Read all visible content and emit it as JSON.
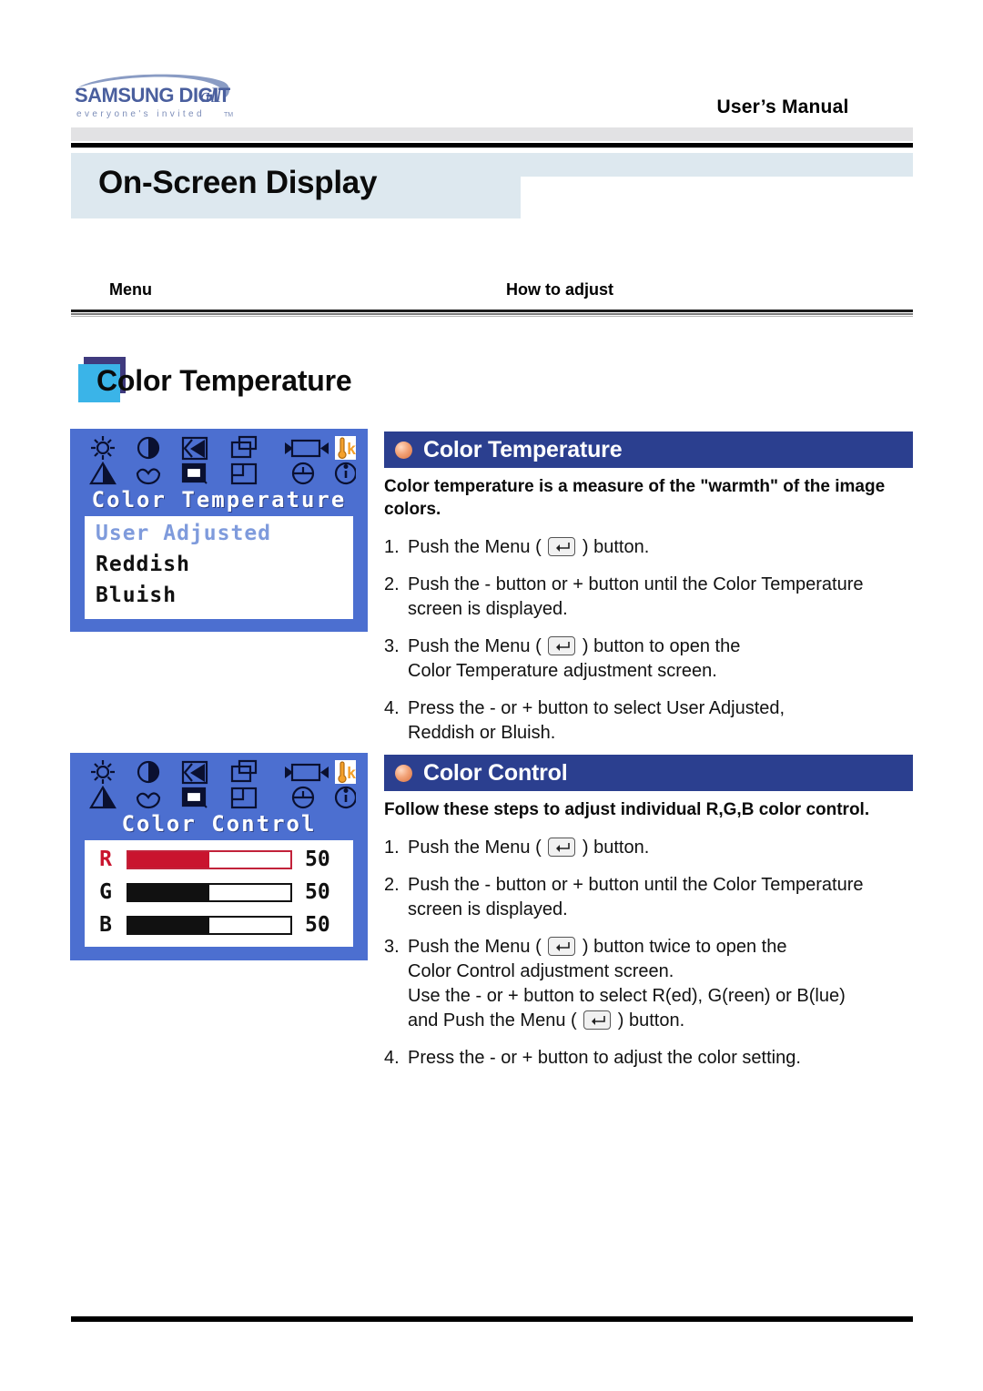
{
  "header": {
    "logo_primary": "SAMSUNG DIGITall",
    "logo_tagline": "everyone's invited™",
    "manual_title": "User’s Manual"
  },
  "banner": {
    "title": "On-Screen Display"
  },
  "columns": {
    "menu": "Menu",
    "how_to_adjust": "How to adjust"
  },
  "section": {
    "title": "Color Temperature"
  },
  "osd_panels": [
    {
      "menu_title": "Color Temperature",
      "options": [
        {
          "label": "User Adjusted",
          "selected": true
        },
        {
          "label": "Reddish",
          "selected": false
        },
        {
          "label": "Bluish",
          "selected": false
        }
      ]
    },
    {
      "menu_title": "Color Control",
      "rows": [
        {
          "label": "R",
          "value": "50",
          "percent": 50,
          "color": "#c9142e"
        },
        {
          "label": "G",
          "value": "50",
          "percent": 50,
          "color": "#111111"
        },
        {
          "label": "B",
          "value": "50",
          "percent": 50,
          "color": "#111111"
        }
      ]
    }
  ],
  "blocks": [
    {
      "heading": "Color Temperature",
      "intro": "Color temperature is a measure of the \"warmth\" of the image colors.",
      "steps": [
        {
          "num": "1.",
          "lines": [
            {
              "pre": "Push the Menu ( ",
              "key": true,
              "post": " ) button."
            }
          ]
        },
        {
          "num": "2.",
          "lines": [
            {
              "pre": "Push the - button or + button until the Color Temperature",
              "key": false,
              "post": ""
            },
            {
              "pre": "screen is displayed.",
              "key": false,
              "post": ""
            }
          ]
        },
        {
          "num": "3.",
          "lines": [
            {
              "pre": "Push the Menu ( ",
              "key": true,
              "post": " ) button to open the"
            },
            {
              "pre": "Color Temperature adjustment screen.",
              "key": false,
              "post": ""
            }
          ]
        },
        {
          "num": "4.",
          "lines": [
            {
              "pre": "Press the - or + button to select User Adjusted,",
              "key": false,
              "post": ""
            },
            {
              "pre": "Reddish or Bluish.",
              "key": false,
              "post": ""
            }
          ]
        }
      ]
    },
    {
      "heading": "Color Control",
      "intro": "Follow these steps to adjust individual R,G,B color control.",
      "steps": [
        {
          "num": "1.",
          "lines": [
            {
              "pre": "Push the Menu ( ",
              "key": true,
              "post": " ) button."
            }
          ]
        },
        {
          "num": "2.",
          "lines": [
            {
              "pre": "Push the - button or + button until the Color Temperature",
              "key": false,
              "post": ""
            },
            {
              "pre": "screen is displayed.",
              "key": false,
              "post": ""
            }
          ]
        },
        {
          "num": "3.",
          "lines": [
            {
              "pre": "Push the Menu ( ",
              "key": true,
              "post": " ) button twice to open the"
            },
            {
              "pre": "Color Control adjustment screen.",
              "key": false,
              "post": ""
            },
            {
              "pre": "Use the - or + button to select R(ed), G(reen) or B(lue)",
              "key": false,
              "post": ""
            },
            {
              "pre": "and Push the Menu ( ",
              "key": true,
              "post": " ) button."
            }
          ]
        },
        {
          "num": "4.",
          "lines": [
            {
              "pre": "Press the - or + button to adjust the color setting.",
              "key": false,
              "post": ""
            }
          ]
        }
      ]
    }
  ],
  "colors": {
    "banner_bg": "#dde8ef",
    "osd_blue": "#4c6fd0",
    "block_head": "#2b3f8f",
    "square_back": "#3f3a7e",
    "square_front": "#3ab4e8",
    "bullet": "#e08a55",
    "red_bar": "#c9142e"
  },
  "osd_icon_names": [
    "brightness-icon",
    "contrast-icon",
    "h-position-icon",
    "image-size-icon",
    "h-size-icon",
    "color-temperature-icon",
    "sharpness-icon",
    "moire-icon",
    "degauss-icon",
    "v-position-icon",
    "osd-timer-icon",
    "information-icon"
  ]
}
